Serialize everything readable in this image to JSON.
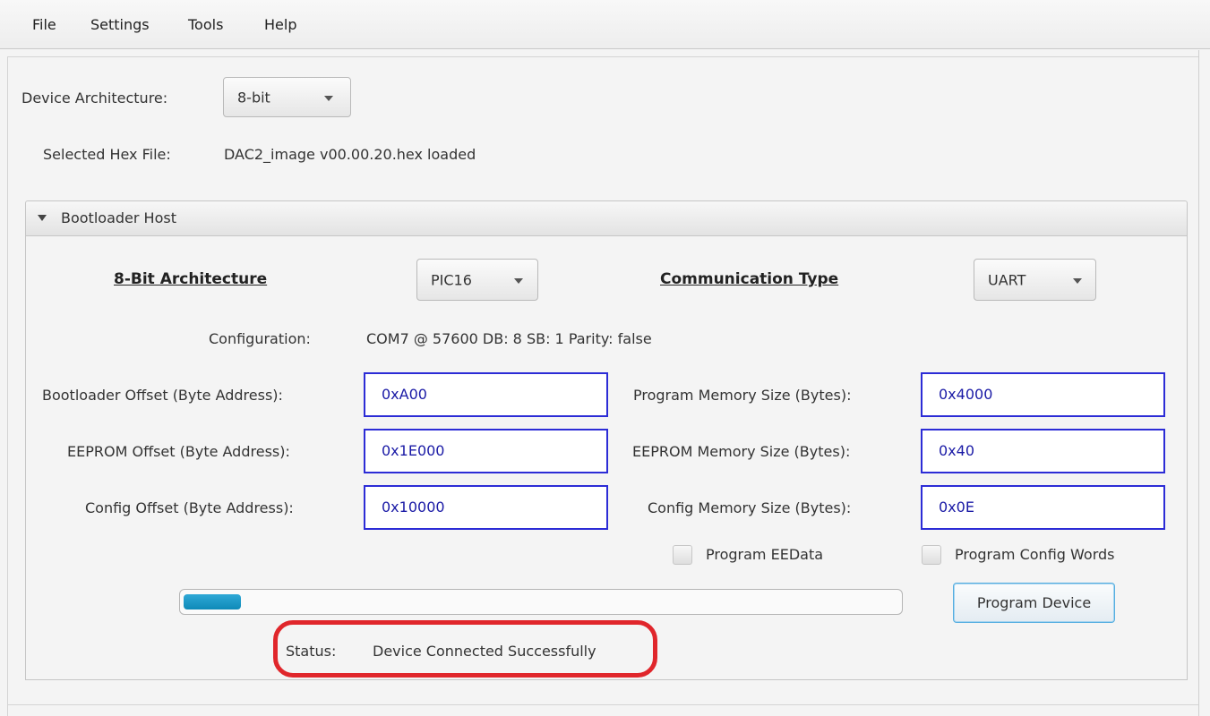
{
  "menu": {
    "file": "File",
    "settings": "Settings",
    "tools": "Tools",
    "help": "Help"
  },
  "device_architecture": {
    "label": "Device Architecture:",
    "value": "8-bit"
  },
  "hex_file": {
    "label": "Selected Hex File:",
    "value": "DAC2_image v00.00.20.hex loaded"
  },
  "bootloader_pane": {
    "title": "Bootloader Host",
    "architecture_header": "8-Bit Architecture",
    "architecture_value": "PIC16",
    "comm_header": "Communication Type",
    "comm_value": "UART",
    "configuration_label": "Configuration:",
    "configuration_value": "COM7 @ 57600 DB: 8 SB: 1 Parity: false",
    "bootloader_offset_label": "Bootloader Offset (Byte Address):",
    "bootloader_offset_value": "0xA00",
    "eeprom_offset_label": "EEPROM Offset (Byte Address):",
    "eeprom_offset_value": "0x1E000",
    "config_offset_label": "Config Offset (Byte Address):",
    "config_offset_value": "0x10000",
    "program_memory_label": "Program Memory Size (Bytes):",
    "program_memory_value": "0x4000",
    "eeprom_memory_label": "EEPROM Memory Size (Bytes):",
    "eeprom_memory_value": "0x40",
    "config_memory_label": "Config Memory Size (Bytes):",
    "config_memory_value": "0x0E",
    "program_eedata_label": "Program EEData",
    "program_eedata_checked": false,
    "program_config_label": "Program Config Words",
    "program_config_checked": false,
    "progress_fraction": 0.08,
    "program_button": "Program Device",
    "status_label": "Status:",
    "status_value": "Device Connected Successfully"
  },
  "colors": {
    "field_border": "#2c2cd6",
    "progress": "#1a97c8",
    "highlight": "#e0262b"
  }
}
